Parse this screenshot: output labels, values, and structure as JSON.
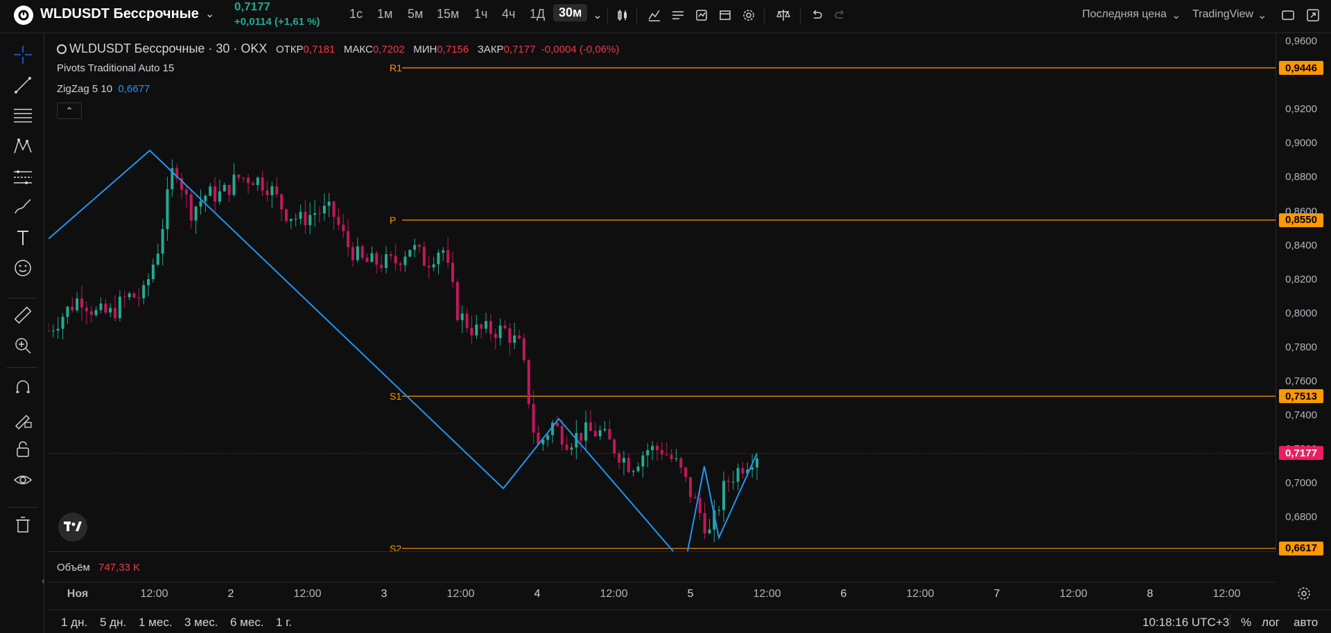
{
  "header": {
    "symbol": "WLDUSDT Бессрочные",
    "price": "0,7177",
    "change": "+0,0114 (+1,61 %)",
    "timeframes": [
      "1с",
      "1м",
      "5м",
      "15м",
      "1ч",
      "4ч",
      "1Д",
      "30м"
    ],
    "active_timeframe": "30м",
    "price_type": "Последняя цена",
    "source": "TradingView"
  },
  "legend": {
    "title": "WLDUSDT Бессрочные · 30 · OKX",
    "open_label": "ОТКР",
    "open": "0,7181",
    "high_label": "МАКС",
    "high": "0,7202",
    "low_label": "МИН",
    "low": "0,7156",
    "close_label": "ЗАКР",
    "close": "0,7177",
    "chg": "-0,0004 (-0,06%)",
    "pivots": "Pivots Traditional Auto 15",
    "zigzag": "ZigZag 5 10",
    "zigzag_val": "0,6677"
  },
  "pivots": {
    "r1_label": "R1",
    "r1": "0,9446",
    "p_label": "P",
    "p": "0,8550",
    "s1_label": "S1",
    "s1": "0,7513",
    "s2_label": "S2",
    "s2": "0,6617",
    "current": "0,7177"
  },
  "price_axis": [
    "0,9600",
    "0,9200",
    "0,9000",
    "0,8800",
    "0,8600",
    "0,8400",
    "0,8200",
    "0,8000",
    "0,7800",
    "0,7600",
    "0,7400",
    "0,7200",
    "0,7000",
    "0,6800"
  ],
  "volume": {
    "label": "Объём",
    "value": "747,33 K"
  },
  "time_axis": [
    "Ноя",
    "12:00",
    "2",
    "12:00",
    "3",
    "12:00",
    "4",
    "12:00",
    "5",
    "12:00",
    "6",
    "12:00",
    "7",
    "12:00",
    "8",
    "12:00"
  ],
  "bottom": {
    "ranges": [
      "1 дн.",
      "5 дн.",
      "1 мес.",
      "3 мес.",
      "6 мес.",
      "1 г."
    ],
    "clock": "10:18:16 UTC+3",
    "pct": "%",
    "log": "лог",
    "auto": "авто"
  },
  "colors": {
    "up": "#22ab94",
    "down": "#f23645",
    "candle_down": "#c2185b",
    "zigzag": "#2196f3",
    "pivot": "#ff9800",
    "current_tag": "#e91e63"
  },
  "chart_data": {
    "type": "candlestick",
    "y_range": [
      0.66,
      0.965
    ],
    "pivots": {
      "R1": 0.9446,
      "P": 0.855,
      "S1": 0.7513,
      "S2": 0.6617
    },
    "zigzag_values": [
      0.844,
      0.896,
      0.697,
      0.738,
      0.652,
      0.71,
      0.668,
      0.7177
    ],
    "close_series": [
      0.79,
      0.8,
      0.81,
      0.8,
      0.8,
      0.81,
      0.81,
      0.84,
      0.89,
      0.86,
      0.87,
      0.87,
      0.88,
      0.88,
      0.875,
      0.86,
      0.855,
      0.86,
      0.86,
      0.84,
      0.83,
      0.83,
      0.83,
      0.84,
      0.83,
      0.84,
      0.8,
      0.79,
      0.79,
      0.79,
      0.78,
      0.72,
      0.735,
      0.725,
      0.73,
      0.73,
      0.72,
      0.71,
      0.72,
      0.72,
      0.71,
      0.69,
      0.67,
      0.7,
      0.71,
      0.7177
    ]
  }
}
